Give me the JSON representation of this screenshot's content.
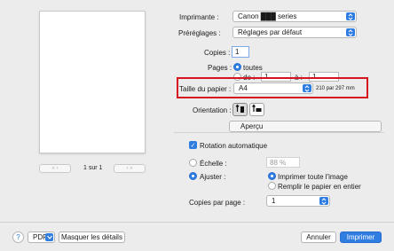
{
  "preview": {
    "page_counter": "1 sur 1",
    "first_glyph": "«  ‹",
    "last_glyph": "›  »"
  },
  "printer": {
    "label": "Imprimante :",
    "value": "Canon ███ series"
  },
  "presets": {
    "label": "Préréglages :",
    "value": "Réglages par défaut"
  },
  "copies": {
    "label": "Copies :",
    "value": "1"
  },
  "pages": {
    "label": "Pages :",
    "all_label": "toutes",
    "from_label": "de :",
    "from_value": "1",
    "to_label": "à :",
    "to_value": "1"
  },
  "paper_size": {
    "label": "Taille du papier :",
    "value": "A4",
    "dimensions": "210 par 297 mm"
  },
  "orientation": {
    "label": "Orientation :"
  },
  "section_popup": {
    "value": "Aperçu"
  },
  "auto_rotate": {
    "label": "Rotation automatique",
    "checked": true
  },
  "scale": {
    "label": "Échelle :",
    "value": "88 %"
  },
  "fit": {
    "label": "Ajuster :",
    "print_entire": "Imprimer toute l'image",
    "fill_paper": "Remplir le papier en entier"
  },
  "copies_per_page": {
    "label": "Copies par page :",
    "value": "1"
  },
  "footer": {
    "help": "?",
    "pdf": "PDF",
    "hide_details": "Masquer les détails",
    "cancel": "Annuler",
    "print": "Imprimer"
  },
  "colors": {
    "accent": "#2f7de1",
    "highlight": "#d4141f"
  },
  "icons": [
    "chevron-updown-icon",
    "portrait-icon",
    "landscape-icon",
    "checkmark-icon",
    "help-icon"
  ]
}
